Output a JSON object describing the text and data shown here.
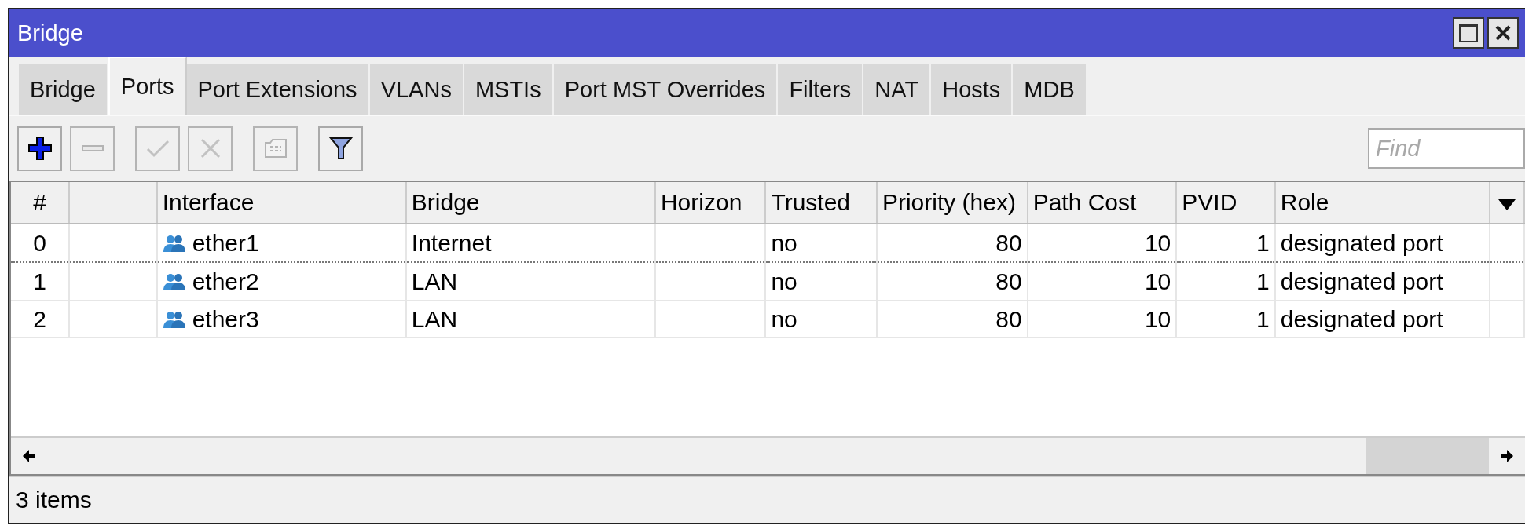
{
  "window": {
    "title": "Bridge"
  },
  "tabs": [
    {
      "label": "Bridge",
      "selected": false
    },
    {
      "label": "Ports",
      "selected": true
    },
    {
      "label": "Port Extensions",
      "selected": false
    },
    {
      "label": "VLANs",
      "selected": false
    },
    {
      "label": "MSTIs",
      "selected": false
    },
    {
      "label": "Port MST Overrides",
      "selected": false
    },
    {
      "label": "Filters",
      "selected": false
    },
    {
      "label": "NAT",
      "selected": false
    },
    {
      "label": "Hosts",
      "selected": false
    },
    {
      "label": "MDB",
      "selected": false
    }
  ],
  "toolbar": [
    {
      "kind": "add",
      "disabled": false
    },
    {
      "kind": "remove",
      "disabled": true
    },
    {
      "kind": "enable",
      "disabled": true
    },
    {
      "kind": "disable",
      "disabled": true
    },
    {
      "kind": "comment",
      "disabled": true
    },
    {
      "kind": "filter",
      "disabled": false
    }
  ],
  "search": {
    "placeholder": "Find"
  },
  "table": {
    "columns": [
      {
        "label": "#"
      },
      {},
      {
        "label": "Interface"
      },
      {
        "label": "Bridge"
      },
      {
        "label": "Horizon"
      },
      {
        "label": "Trusted"
      },
      {
        "label": "Priority (hex)"
      },
      {
        "label": "Path Cost"
      },
      {
        "label": "PVID"
      },
      {
        "label": "Role"
      }
    ],
    "rows": [
      {
        "focused": true,
        "cells": [
          "0",
          "",
          "ether1",
          "Internet",
          "",
          "no",
          "80",
          "10",
          "1",
          "designated port"
        ]
      },
      {
        "focused": false,
        "cells": [
          "1",
          "",
          "ether2",
          "LAN",
          "",
          "no",
          "80",
          "10",
          "1",
          "designated port"
        ]
      },
      {
        "focused": false,
        "cells": [
          "2",
          "",
          "ether3",
          "LAN",
          "",
          "no",
          "80",
          "10",
          "1",
          "designated port"
        ]
      }
    ]
  },
  "status_bar": {
    "text": "3 items"
  }
}
